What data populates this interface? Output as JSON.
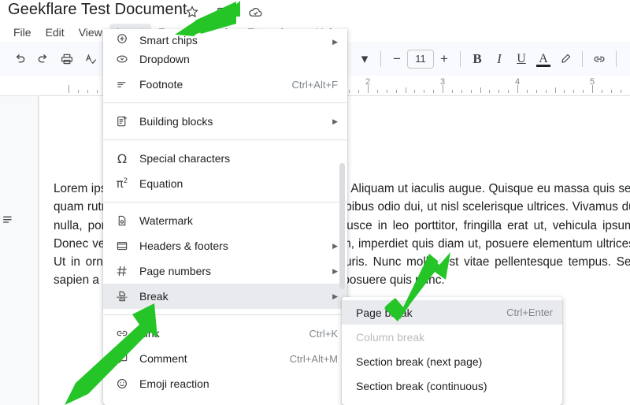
{
  "app": {
    "doc_title": "Geekflare Test Document",
    "title_icons": [
      "star-icon",
      "move-to-folder-icon",
      "cloud-saved-icon"
    ]
  },
  "menubar": {
    "items": [
      {
        "label": "File",
        "active": false
      },
      {
        "label": "Edit",
        "active": false
      },
      {
        "label": "View",
        "active": false
      },
      {
        "label": "Insert",
        "active": true
      },
      {
        "label": "Format",
        "active": false
      },
      {
        "label": "Tools",
        "active": false
      },
      {
        "label": "Extensions",
        "active": false
      },
      {
        "label": "Help",
        "active": false
      }
    ]
  },
  "toolbar": {
    "undo": "undo-icon",
    "redo": "redo-icon",
    "print": "print-icon",
    "spellcheck": "spellcheck-icon",
    "font_size_value": "11",
    "decrease_font": "−",
    "increase_font": "+",
    "bold": "B",
    "italic": "I",
    "underline": "U",
    "text_color": "A",
    "highlight": "highlight-pen-icon",
    "insert_link": "link-icon",
    "dropdown_caret": "▾"
  },
  "ruler": {
    "numbers": [
      "2",
      "3",
      "4",
      "5"
    ]
  },
  "insert_menu": {
    "items": [
      {
        "id": "smart-chips",
        "label": "Smart chips",
        "icon": "smart-chip-icon",
        "accel": "",
        "arrow": true,
        "highlight": false,
        "clipped": true
      },
      {
        "id": "dropdown",
        "label": "Dropdown",
        "icon": "dropdown-icon",
        "accel": "",
        "arrow": false,
        "highlight": false
      },
      {
        "id": "footnote",
        "label": "Footnote",
        "icon": "footnote-icon",
        "accel": "Ctrl+Alt+F",
        "arrow": false,
        "highlight": false
      },
      {
        "id": "sep1",
        "separator": true
      },
      {
        "id": "building-blocks",
        "label": "Building blocks",
        "icon": "building-blocks-icon",
        "accel": "",
        "arrow": true,
        "highlight": false
      },
      {
        "id": "sep2",
        "separator": true
      },
      {
        "id": "special-characters",
        "label": "Special characters",
        "icon": "omega-icon",
        "accel": "",
        "arrow": false,
        "highlight": false
      },
      {
        "id": "equation",
        "label": "Equation",
        "icon": "pi-squared-icon",
        "accel": "",
        "arrow": false,
        "highlight": false
      },
      {
        "id": "sep3",
        "separator": true
      },
      {
        "id": "watermark",
        "label": "Watermark",
        "icon": "watermark-icon",
        "accel": "",
        "arrow": false,
        "highlight": false
      },
      {
        "id": "headers-footers",
        "label": "Headers & footers",
        "icon": "headers-footers-icon",
        "accel": "",
        "arrow": true,
        "highlight": false
      },
      {
        "id": "page-numbers",
        "label": "Page numbers",
        "icon": "hash-icon",
        "accel": "",
        "arrow": true,
        "highlight": false
      },
      {
        "id": "break",
        "label": "Break",
        "icon": "break-icon",
        "accel": "",
        "arrow": true,
        "highlight": true
      },
      {
        "id": "sep4",
        "separator": true
      },
      {
        "id": "link",
        "label": "Link",
        "icon": "link-icon",
        "accel": "Ctrl+K",
        "arrow": false,
        "highlight": false
      },
      {
        "id": "comment",
        "label": "Comment",
        "icon": "comment-plus-icon",
        "accel": "Ctrl+Alt+M",
        "arrow": false,
        "highlight": false
      },
      {
        "id": "emoji-reaction",
        "label": "Emoji reaction",
        "icon": "emoji-icon",
        "accel": "",
        "arrow": false,
        "highlight": false
      }
    ]
  },
  "break_submenu": {
    "items": [
      {
        "id": "page-break",
        "label": "Page break",
        "accel": "Ctrl+Enter",
        "highlight": true,
        "disabled": false
      },
      {
        "id": "column-break",
        "label": "Column break",
        "accel": "",
        "highlight": false,
        "disabled": true
      },
      {
        "id": "section-break-next-page",
        "label": "Section break (next page)",
        "accel": "",
        "highlight": false,
        "disabled": false
      },
      {
        "id": "section-break-continuous",
        "label": "Section break (continuous)",
        "accel": "",
        "highlight": false,
        "disabled": false
      }
    ]
  },
  "document": {
    "body_text": "Lorem ipsum dolor sit amet, consectetur adipiscing elit. Aliquam ut iaculis augue. Quisque eu massa quis sed quam rutrum scelerisque. Integer a elit dolor. Etiam dapibus odio dui, ut nisl scelerisque ultrices. Vivamus dui nulla, porttitor eget neque vitae, hendrerit in risus. Fusce in leo porttitor, fringilla erat ut, vehicula ipsum. Donec vehicula in, rhoncus et erat. Curabitur felis diam, imperdiet quis diam ut, posuere elementum ultrices. Ut in ornare lorem. Nunc vitae nibh. Morbi id ex mauris. Nunc mollis est vitae pellentesque tempus. Sed sapien a leo mollis nunc posuere pulvinar. Morbi vitae posuere quis nunc.",
    "outline_icon": "outline-icon"
  },
  "annotations": {
    "arrow_color": "#25C528",
    "arrows": [
      {
        "id": "arrow-insert-menu",
        "points_to": "Insert"
      },
      {
        "id": "arrow-break-item",
        "points_to": "Break"
      },
      {
        "id": "arrow-page-break",
        "points_to": "Page break"
      }
    ]
  }
}
